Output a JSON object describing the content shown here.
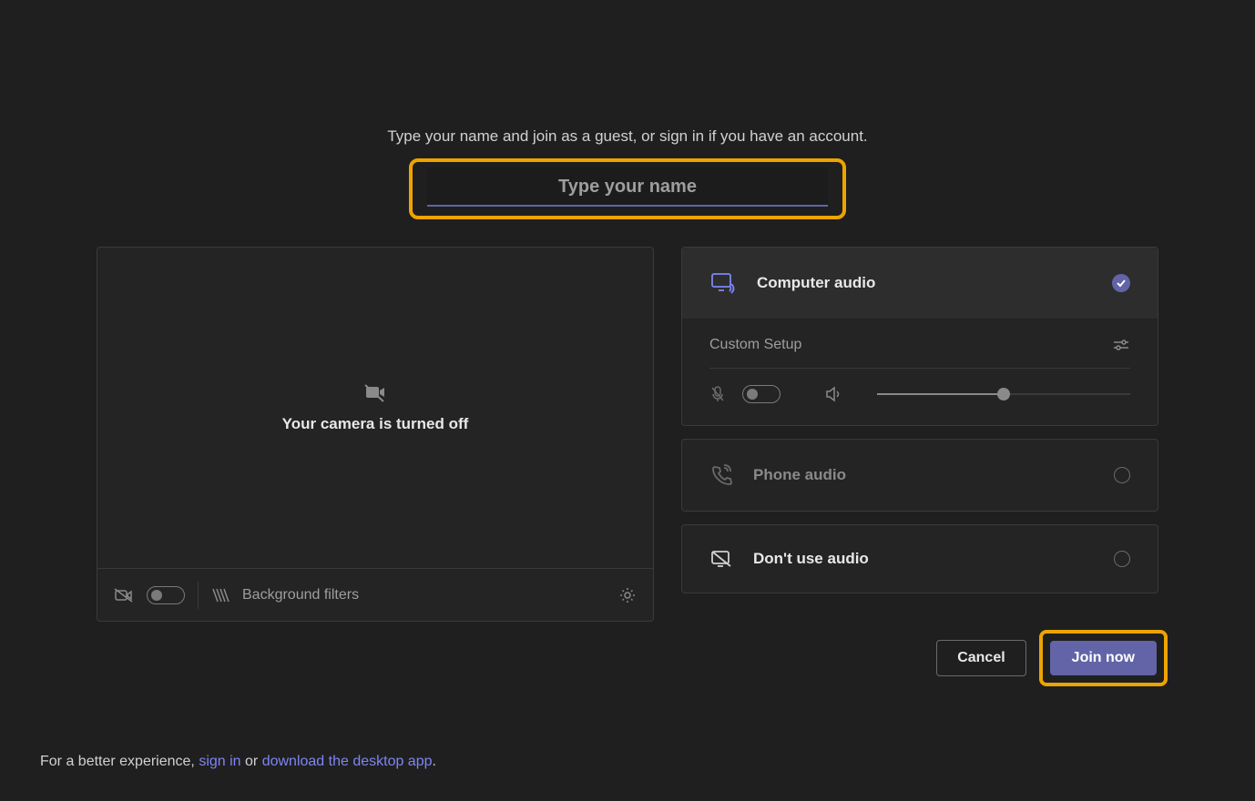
{
  "instruction": "Type your name and join as a guest, or sign in if you have an account.",
  "nameInput": {
    "placeholder": "Type your name",
    "value": ""
  },
  "camera": {
    "offText": "Your camera is turned off",
    "bgFiltersLabel": "Background filters"
  },
  "audio": {
    "computer": {
      "label": "Computer audio"
    },
    "custom": {
      "label": "Custom Setup",
      "volumePct": 50
    },
    "phone": {
      "label": "Phone audio"
    },
    "none": {
      "label": "Don't use audio"
    }
  },
  "actions": {
    "cancel": "Cancel",
    "join": "Join now"
  },
  "footer": {
    "prefix": "For a better experience, ",
    "signIn": "sign in",
    "middle": " or ",
    "download": "download the desktop app",
    "suffix": "."
  }
}
